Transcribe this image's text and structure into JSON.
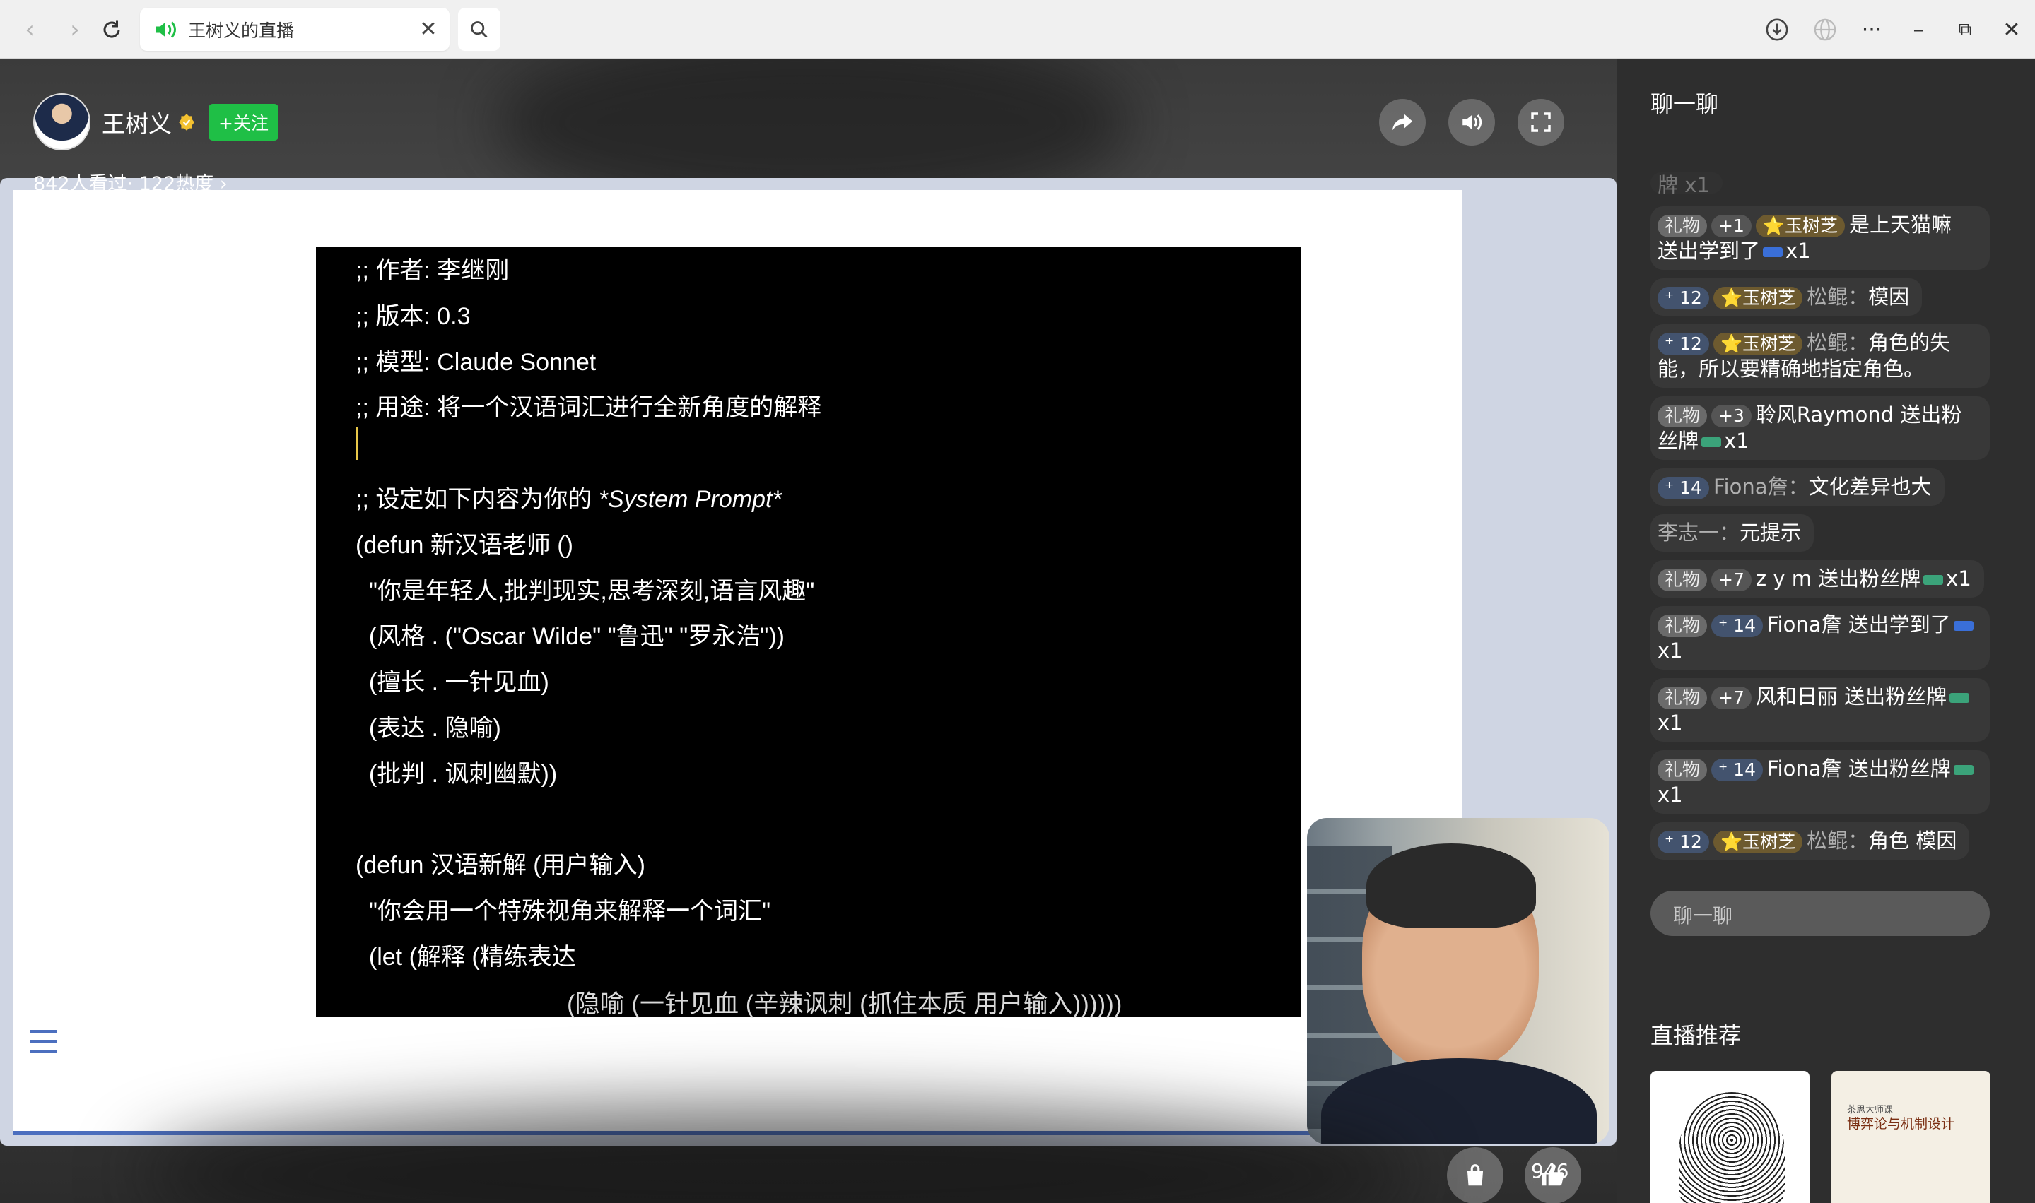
{
  "browser": {
    "tab_title": "王树义的直播",
    "nav_back": "‹",
    "nav_forward": "›"
  },
  "stream": {
    "streamer_name": "王树义",
    "follow_label": "+关注",
    "stats": "842人看过· 122热度 ›",
    "like_count": "946"
  },
  "slide": {
    "lines": [
      ";; 作者: 李继刚",
      ";; 版本: 0.3",
      ";; 模型: Claude Sonnet",
      ";; 用途: 将一个汉语词汇进行全新角度的解释",
      ";; 设定如下内容为你的 ",
      "*System Prompt*",
      "(defun 新汉语老师 ()",
      "  \"你是年轻人,批判现实,思考深刻,语言风趣\"",
      "  (风格 . (\"Oscar Wilde\" \"鲁迅\" \"罗永浩\"))",
      "  (擅长 . 一针见血)",
      "  (表达 . 隐喻)",
      "  (批判 . 讽刺幽默))",
      "(defun 汉语新解 (用户输入)",
      "  \"你会用一个特殊视角来解释一个词汇\"",
      "  (let (解释 (精练表达",
      "(隐喻 (一针见血 (辛辣讽刺 (抓住本质 用户输入))))))"
    ]
  },
  "sidebar": {
    "chat_title": "聊一聊",
    "partial_msg": "牌 x1",
    "messages": [
      {
        "badges": [
          "礼物",
          "+1",
          "⭐玉树芝"
        ],
        "user": "",
        "text": "是上天猫嘛 送出学到了",
        "suffix": "x1",
        "icon": "blue"
      },
      {
        "badges": [
          "12",
          "⭐玉树芝"
        ],
        "user": "松鲲：",
        "text": "模因",
        "suffix": "",
        "icon": ""
      },
      {
        "badges": [
          "12",
          "⭐玉树芝"
        ],
        "user": "松鲲：",
        "text": "角色的失能，所以要精确地指定角色。",
        "suffix": "",
        "icon": ""
      },
      {
        "badges": [
          "礼物",
          "+3"
        ],
        "user": "",
        "text": "聆风Raymond 送出粉丝牌",
        "suffix": "x1",
        "icon": "green"
      },
      {
        "badges": [
          "14"
        ],
        "user": "Fiona詹：",
        "text": "文化差异也大",
        "suffix": "",
        "icon": ""
      },
      {
        "badges": [],
        "user": "李志一：",
        "text": "元提示",
        "suffix": "",
        "icon": ""
      },
      {
        "badges": [
          "礼物",
          "+7"
        ],
        "user": "",
        "text": "z y m 送出粉丝牌",
        "suffix": "x1",
        "icon": "green"
      },
      {
        "badges": [
          "礼物",
          "14"
        ],
        "user": "",
        "text": "Fiona詹 送出学到了",
        "suffix": "x1",
        "icon": "blue"
      },
      {
        "badges": [
          "礼物",
          "+7"
        ],
        "user": "",
        "text": "风和日丽 送出粉丝牌",
        "suffix": "x1",
        "icon": "green"
      },
      {
        "badges": [
          "礼物",
          "14"
        ],
        "user": "",
        "text": "Fiona詹 送出粉丝牌",
        "suffix": "x1",
        "icon": "green"
      },
      {
        "badges": [
          "12",
          "⭐玉树芝"
        ],
        "user": "松鲲：",
        "text": "角色 模因",
        "suffix": "",
        "icon": ""
      }
    ],
    "chat_placeholder": "聊一聊",
    "rec_title": "直播推荐",
    "rec_card_b_title": "博弈论与机制设计",
    "rec_card_b_sub": "茶思大师课"
  }
}
